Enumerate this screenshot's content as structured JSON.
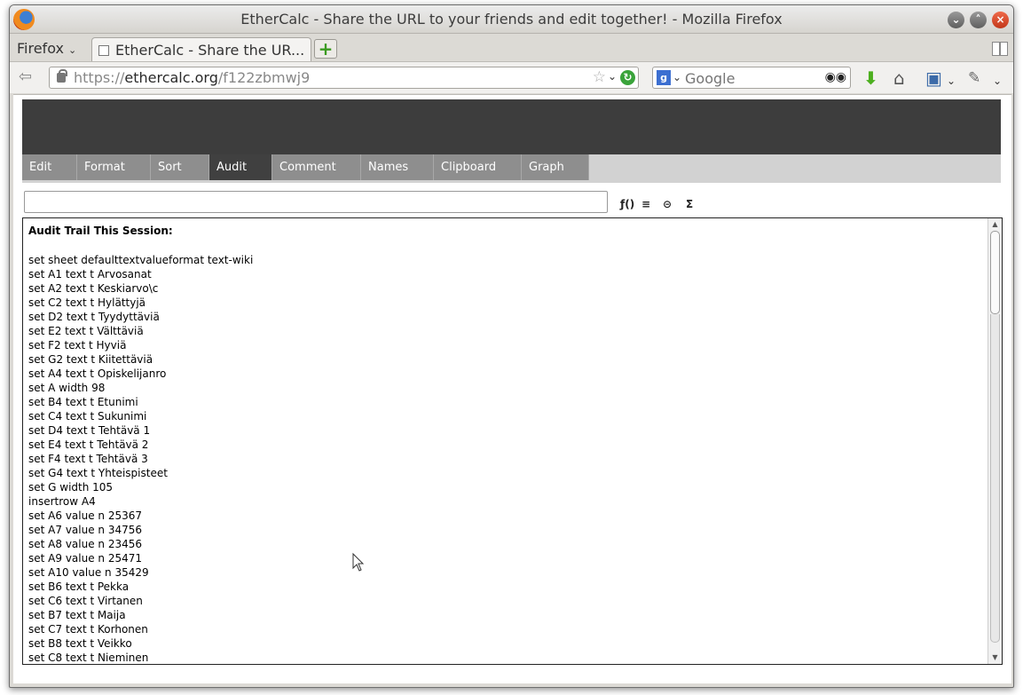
{
  "window": {
    "title": "EtherCalc - Share the URL to your friends and edit together! - Mozilla Firefox",
    "controls": [
      "minimize",
      "maximize",
      "close"
    ]
  },
  "browser": {
    "menu_label": "Firefox",
    "tab_title": "EtherCalc - Share the UR...",
    "url_prefix": "https://",
    "url_domain": "ethercalc.org",
    "url_path": "/f122zbmwj9",
    "search_placeholder": "Google",
    "search_engine_letter": "g"
  },
  "app": {
    "menu_tabs": [
      {
        "label": "Edit",
        "active": false
      },
      {
        "label": "Format",
        "active": false
      },
      {
        "label": "Sort",
        "active": false
      },
      {
        "label": "Audit",
        "active": true
      },
      {
        "label": "Comment",
        "active": false
      },
      {
        "label": "Names",
        "active": false
      },
      {
        "label": "Clipboard",
        "active": false
      },
      {
        "label": "Graph",
        "active": false
      }
    ],
    "formula_value": "",
    "toolbar_icons": [
      "function-icon",
      "align-icon",
      "link-icon",
      "sum-icon"
    ],
    "toolbar_glyphs": [
      "ƒ()",
      "≡",
      "⊝",
      "Σ"
    ]
  },
  "audit": {
    "title": "Audit Trail This Session:",
    "lines": [
      "set sheet defaulttextvalueformat text-wiki",
      "set A1 text t Arvosanat",
      "set A2 text t Keskiarvo\\c",
      "set C2 text t Hylättyjä",
      "set D2 text t Tyydyttäviä",
      "set E2 text t Välttäviä",
      "set F2 text t Hyviä",
      "set G2 text t Kiitettäviä",
      "set A4 text t Opiskelijanro",
      "set A width 98",
      "set B4 text t Etunimi",
      "set C4 text t Sukunimi",
      "set D4 text t Tehtävä 1",
      "set E4 text t Tehtävä 2",
      "set F4 text t Tehtävä 3",
      "set G4 text t Yhteispisteet",
      "set G width 105",
      "insertrow A4",
      "set A6 value n 25367",
      "set A7 value n 34756",
      "set A8 value n 23456",
      "set A9 value n 25471",
      "set A10 value n 35429",
      "set B6 text t Pekka",
      "set C6 text t Virtanen",
      "set B7 text t Maija",
      "set C7 text t Korhonen",
      "set B8 text t Veikko",
      "set C8 text t Nieminen"
    ]
  }
}
